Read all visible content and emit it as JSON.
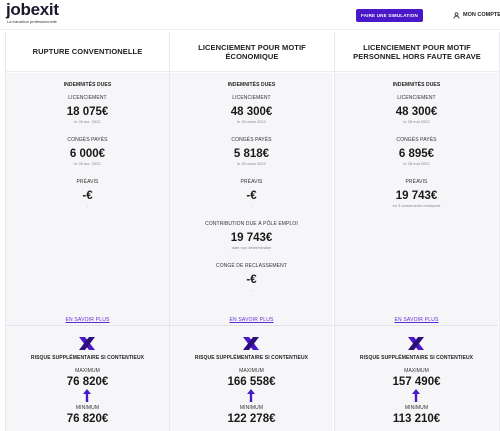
{
  "header": {
    "logo_text": "jobexit",
    "logo_tagline": "La transition professionnelle",
    "cta_label": "FAIRE UNE SIMULATION",
    "account_label": "MON COMPTE",
    "accent": "#4a18c9"
  },
  "columns": [
    {
      "title": "RUPTURE CONVENTIONELLE",
      "indemnites_title": "INDEMNITÉS DUES",
      "licenciement_label": "LICENCIEMENT",
      "licenciement_amount": "18 075€",
      "licenciement_date": "le 09 avr. 2022",
      "conges_label": "CONGÉS PAYÉS",
      "conges_amount": "6 000€",
      "conges_date": "le 09 avr. 2022",
      "preavis_label": "PRÉAVIS",
      "preavis_amount": "-€",
      "preavis_note": "-",
      "more_label": "EN SAVOIR PLUS",
      "risk_title": "RISQUE SUPPLÉMENTAIRE SI CONTENTIEUX",
      "max_label": "MAXIMUM",
      "max_amount": "76 820€",
      "min_label": "MINIMUM",
      "min_amount": "76 820€"
    },
    {
      "title": "LICENCIEMENT POUR MOTIF ÉCONOMIQUE",
      "indemnites_title": "INDEMNITÉS DUES",
      "licenciement_label": "LICENCIEMENT",
      "licenciement_amount": "48 300€",
      "licenciement_date": "le 30 mars 2022",
      "conges_label": "CONGÉS PAYÉS",
      "conges_amount": "5 818€",
      "conges_date": "le 30 mars 2022",
      "preavis_label": "PRÉAVIS",
      "preavis_amount": "-€",
      "preavis_note": "-",
      "contribution_label": "CONTRIBUTION DUE À PÔLE EMPLOI",
      "contribution_amount": "19 743€",
      "contribution_note": "date non déterminable",
      "reclassement_label": "CONGÉ DE RECLASSEMENT",
      "reclassement_amount": "-€",
      "reclassement_note": "-",
      "more_label": "EN SAVOIR PLUS",
      "risk_title": "RISQUE SUPPLÉMENTAIRE SI CONTENTIEUX",
      "max_label": "MAXIMUM",
      "max_amount": "166 558€",
      "min_label": "MINIMUM",
      "min_amount": "122 278€"
    },
    {
      "title": "LICENCIEMENT POUR MOTIF PERSONNEL HORS FAUTE GRAVE",
      "indemnites_title": "INDEMNITÉS DUES",
      "licenciement_label": "LICENCIEMENT",
      "licenciement_amount": "48 300€",
      "licenciement_date": "le 28 mai 2022",
      "conges_label": "CONGÉS PAYÉS",
      "conges_amount": "6 895€",
      "conges_date": "le 28 mai 2022",
      "preavis_label": "PRÉAVIS",
      "preavis_amount": "19 743€",
      "preavis_note": "en 3 versements mensuels",
      "more_label": "EN SAVOIR PLUS",
      "risk_title": "RISQUE SUPPLÉMENTAIRE SI CONTENTIEUX",
      "max_label": "MAXIMUM",
      "max_amount": "157 490€",
      "min_label": "MINIMUM",
      "min_amount": "113 210€"
    }
  ]
}
